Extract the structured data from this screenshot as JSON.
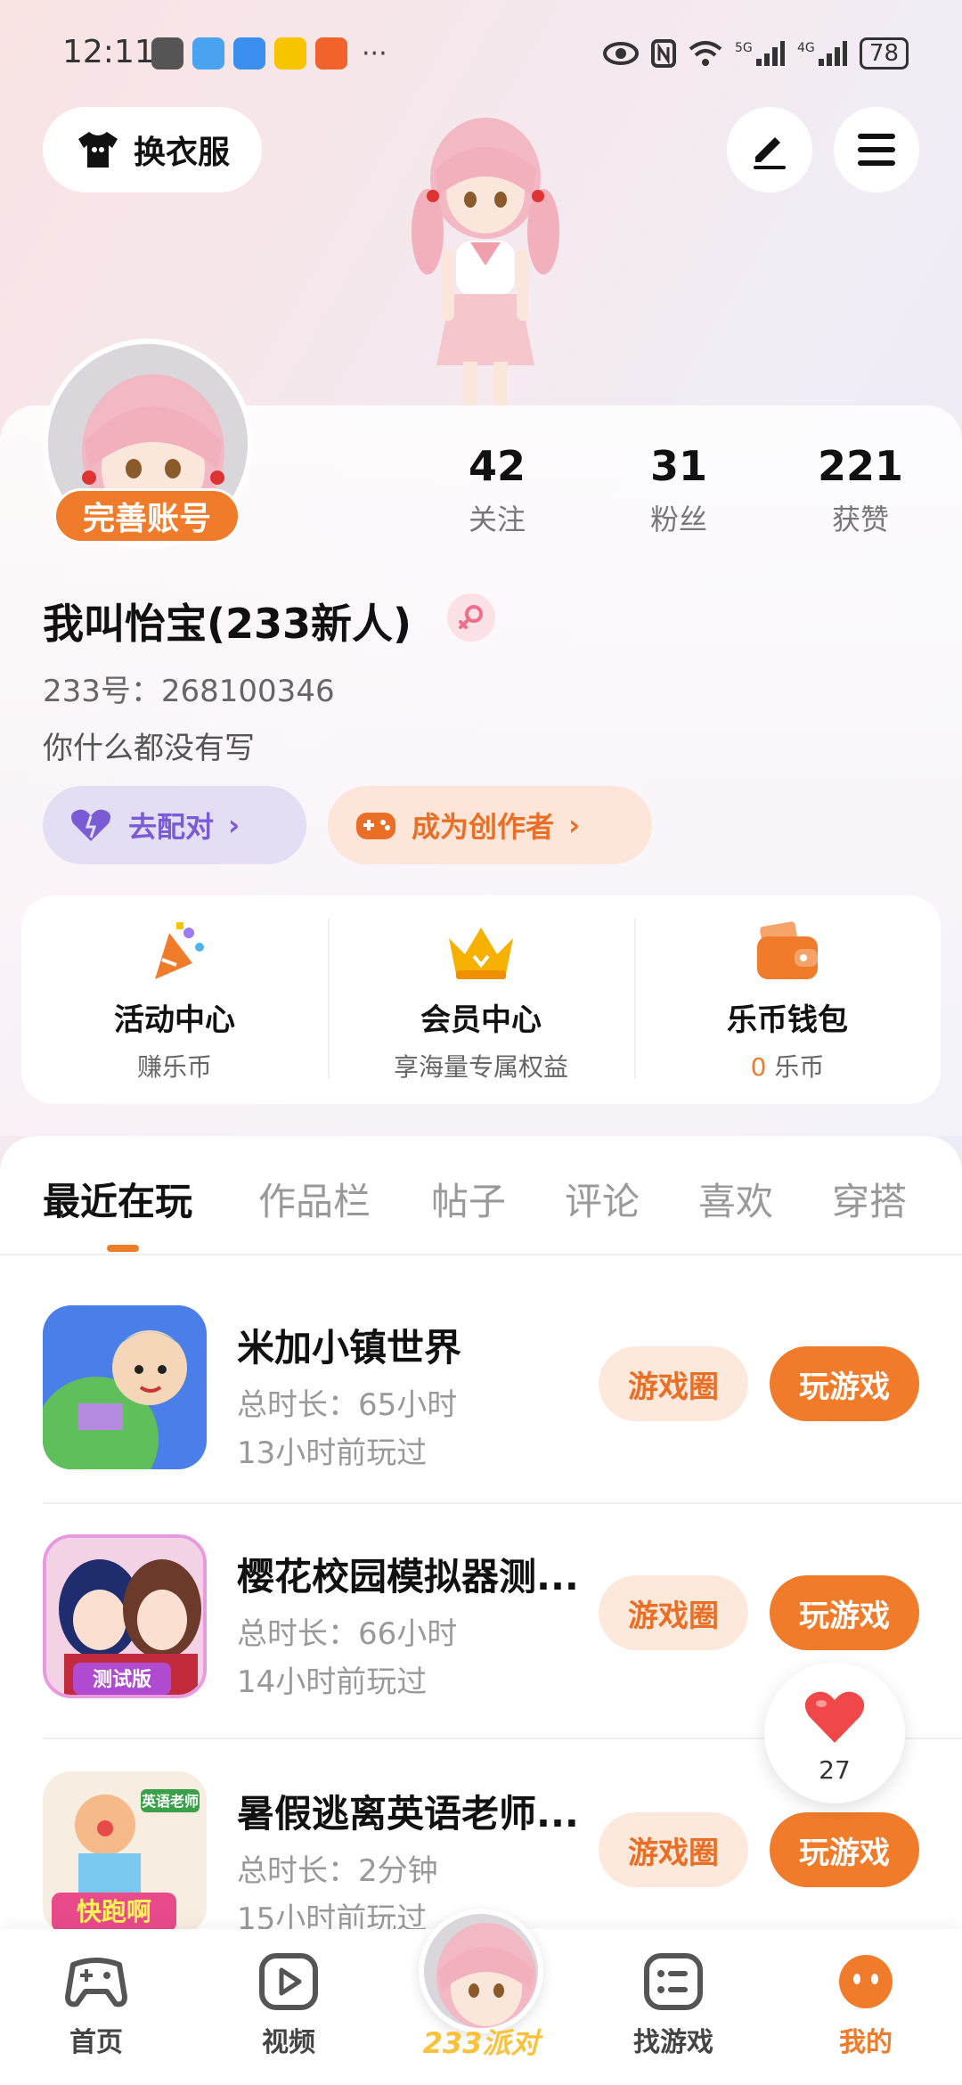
{
  "status_bar": {
    "time": "12:11",
    "battery": "78",
    "network": "5G 4G"
  },
  "header": {
    "outfit_label": "换衣服"
  },
  "profile": {
    "complete_badge": "完善账号",
    "name": "我叫怡宝(233新人)",
    "uid": "233号：268100346",
    "bio": "你什么都没有写",
    "stats": [
      {
        "value": "42",
        "label": "关注"
      },
      {
        "value": "31",
        "label": "粉丝"
      },
      {
        "value": "221",
        "label": "获赞"
      }
    ],
    "match_button": "去配对",
    "creator_button": "成为创作者"
  },
  "features": [
    {
      "title": "活动中心",
      "subtitle": "赚乐币"
    },
    {
      "title": "会员中心",
      "subtitle": "享海量专属权益"
    },
    {
      "title": "乐币钱包",
      "subtitle_value": "0",
      "subtitle_unit": "乐币"
    }
  ],
  "tabs": [
    "最近在玩",
    "作品栏",
    "帖子",
    "评论",
    "喜欢",
    "穿搭"
  ],
  "games": [
    {
      "title": "米加小镇世界",
      "duration": "总时长：65小时",
      "last_played": "13小时前玩过"
    },
    {
      "title": "樱花校园模拟器测...",
      "duration": "总时长：66小时",
      "last_played": "14小时前玩过"
    },
    {
      "title": "暑假逃离英语老师...",
      "duration": "总时长：2分钟",
      "last_played": "15小时前玩过"
    }
  ],
  "game_buttons": {
    "circle": "游戏圈",
    "play": "玩游戏"
  },
  "game_icon_text": {
    "sakura": "测试版",
    "escape_tag": "英语老师",
    "escape_text": "快跑啊"
  },
  "heart": {
    "count": "27"
  },
  "bottom_nav": [
    {
      "label": "首页"
    },
    {
      "label": "视频"
    },
    {
      "label": "233派对"
    },
    {
      "label": "找游戏"
    },
    {
      "label": "我的"
    }
  ],
  "colors": {
    "accent": "#f07b2b",
    "accent_light": "#fde8dc",
    "purple": "#7a5bd6",
    "heart": "#f04848"
  }
}
